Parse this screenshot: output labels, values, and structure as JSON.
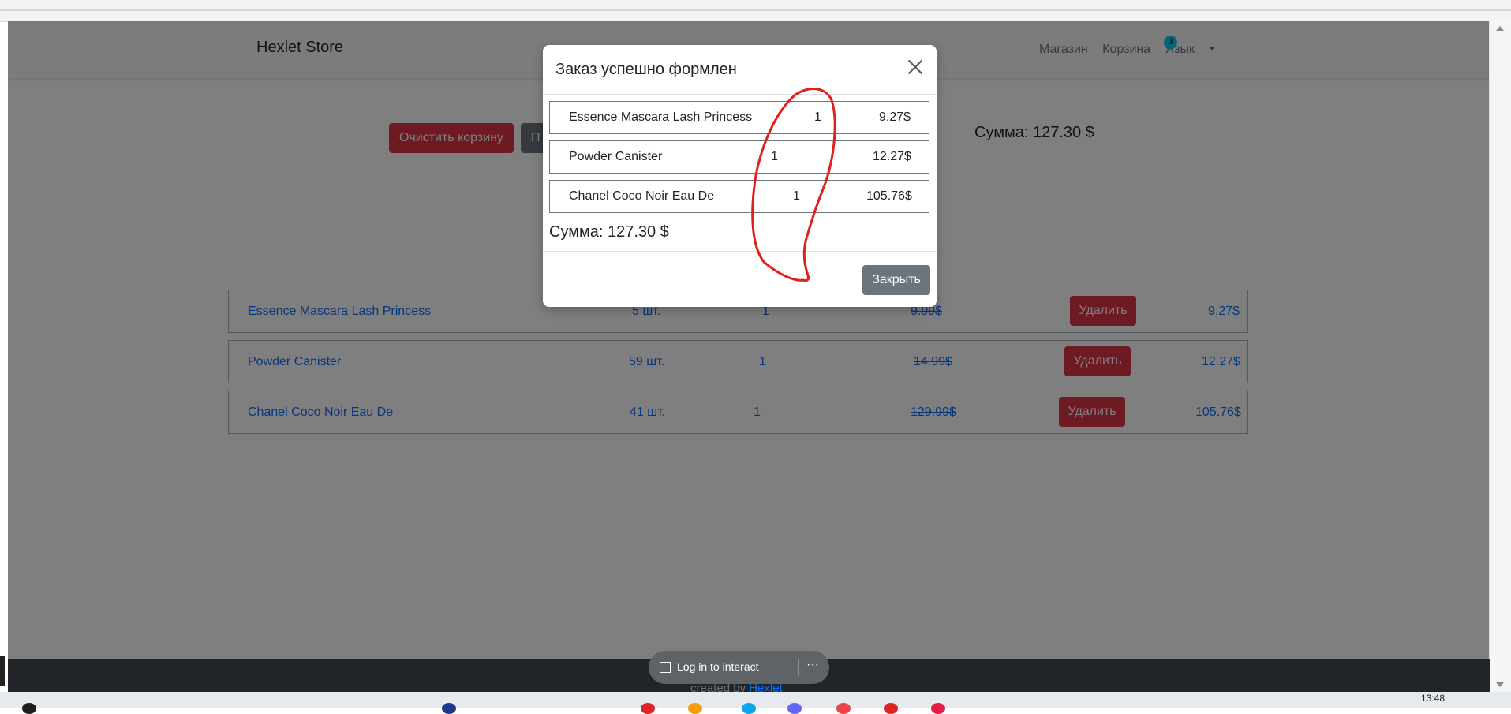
{
  "navbar": {
    "brand": "Hexlet Store",
    "links": {
      "shop": "Магазин",
      "cart": "Корзина",
      "lang": "Язык"
    },
    "cart_count": "3"
  },
  "cart": {
    "clear_label": "Очистить корзину",
    "checkout_label": "П",
    "sum_label": "Сумма: 127.30 $",
    "items": [
      {
        "name": "Essence Mascara Lash Princess",
        "stock": "5 шт.",
        "qty": "1",
        "old_price": "9.99$",
        "delete_label": "Удалить",
        "price": "9.27$"
      },
      {
        "name": "Powder Canister",
        "stock": "59 шт.",
        "qty": "1",
        "old_price": "14.99$",
        "delete_label": "Удалить",
        "price": "12.27$"
      },
      {
        "name": "Chanel Coco Noir Eau De",
        "stock": "41 шт.",
        "qty": "1",
        "old_price": "129.99$",
        "delete_label": "Удалить",
        "price": "105.76$"
      }
    ]
  },
  "modal": {
    "title": "Заказ успешно формлен",
    "items": [
      {
        "name": "Essence Mascara Lash Princess",
        "qty": "1",
        "price": "9.27$"
      },
      {
        "name": "Powder Canister",
        "qty": "1",
        "price": "12.27$"
      },
      {
        "name": "Chanel Coco Noir Eau De",
        "qty": "1",
        "price": "105.76$"
      }
    ],
    "sum_label": "Сумма: 127.30 $",
    "close_label": "Закрыть",
    "annotation_color": "#e0201b"
  },
  "footer": {
    "created_prefix": "created by",
    "created_link": "Hexlet"
  },
  "login_pill": {
    "label": "Log in to interact",
    "more": "···"
  },
  "taskbar": {
    "time": "13:48"
  },
  "colors": {
    "danger": "#dc3545",
    "secondary": "#6c757d",
    "link": "#0d6efd",
    "badge": "#0dcaf0"
  }
}
